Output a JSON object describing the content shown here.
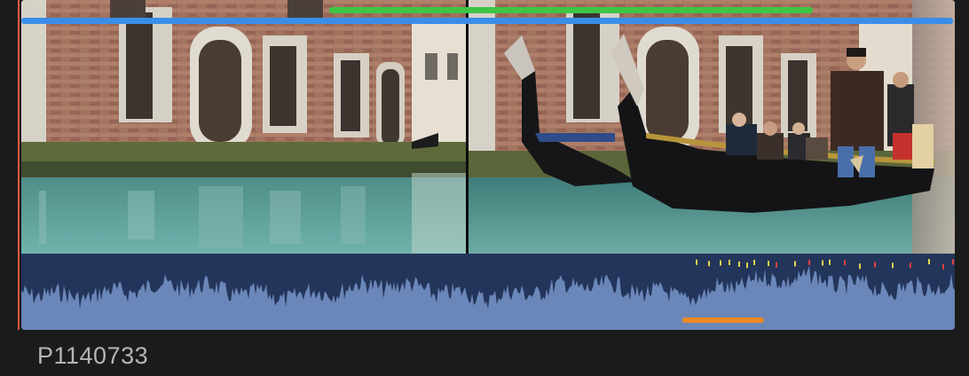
{
  "clip": {
    "name": "P1140733"
  },
  "colors": {
    "background": "#1b1b1c",
    "range_selection": "#3a8ee8",
    "favorite_marker": "#3fc545",
    "playhead": "#e2593e",
    "audio_waveform_fill": "#6b86b8",
    "audio_waveform_dark": "#23355a",
    "keyword_marker": "#f08a24"
  },
  "icons": {
    "playhead": "playhead-line"
  }
}
